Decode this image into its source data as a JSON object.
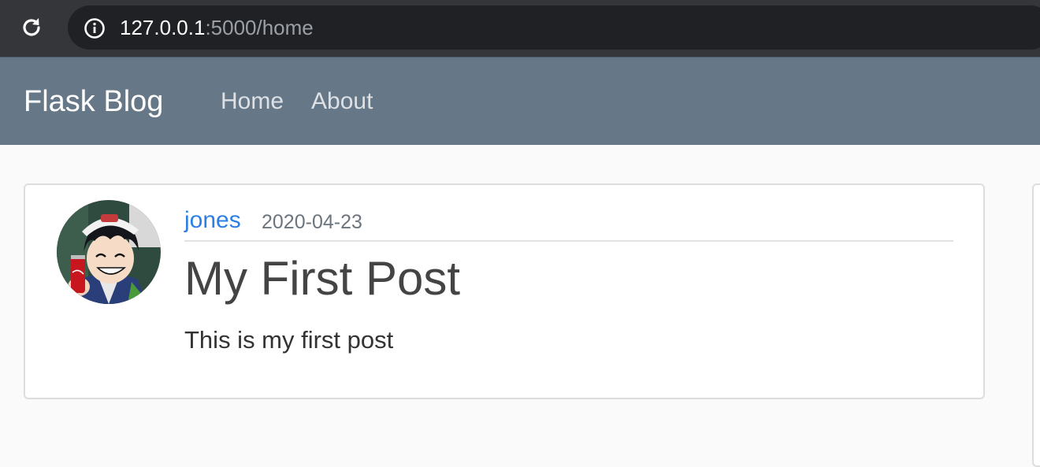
{
  "browser": {
    "url_host": "127.0.0.1",
    "url_rest": ":5000/home",
    "reload_icon": "reload-icon",
    "info_icon": "info-icon"
  },
  "navbar": {
    "brand": "Flask Blog",
    "links": [
      {
        "label": "Home"
      },
      {
        "label": "About"
      }
    ],
    "background": "#667887"
  },
  "post": {
    "author": "jones",
    "date": "2020-04-23",
    "title": "My First Post",
    "content": "This is my first post",
    "author_color": "#2d7fe4"
  }
}
